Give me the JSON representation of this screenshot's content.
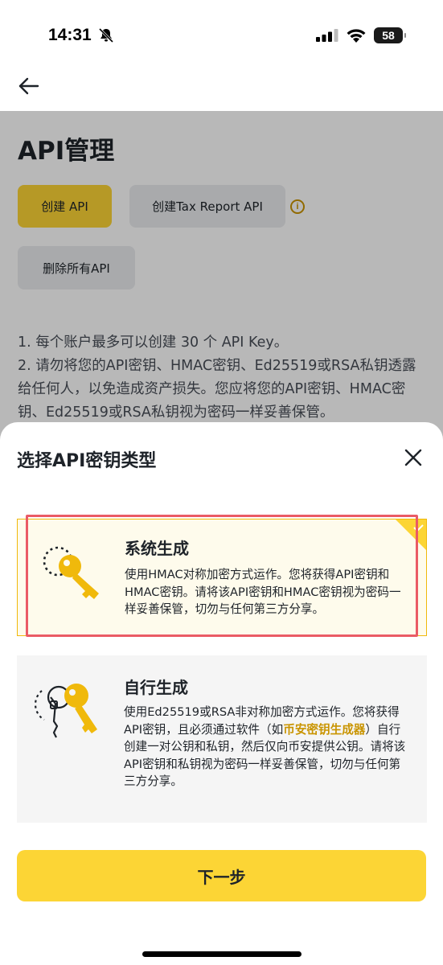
{
  "status_bar": {
    "time": "14:31",
    "battery": "58"
  },
  "page": {
    "title": "API管理",
    "buttons": {
      "create_api": "创建 API",
      "create_tax_api": "创建Tax Report API",
      "delete_all": "删除所有API"
    },
    "notes": [
      "1. 每个账户最多可以创建 30 个 API Key。",
      "2. 请勿将您的API密钥、HMAC密钥、Ed25519或RSA私钥透露给任何人，以免造成资产损失。您应将您的API密钥、HMAC密钥、Ed25519或RSA私钥视为密码一样妥善保管。"
    ]
  },
  "sheet": {
    "title": "选择API密钥类型",
    "options": [
      {
        "title": "系统生成",
        "description": "使用HMAC对称加密方式运作。您将获得API密钥和HMAC密钥。请将该API密钥和HMAC密钥视为密码一样妥善保管，切勿与任何第三方分享。",
        "selected": true
      },
      {
        "title": "自行生成",
        "description_before": "使用Ed25519或RSA非对称加密方式运作。您将获得API密钥，且必须通过软件（如",
        "description_link": "币安密钥生成器",
        "description_after": "）自行创建一对公钥和私钥，然后仅向币安提供公钥。请将该API密钥和私钥视为密码一样妥善保管，切勿与任何第三方分享。",
        "selected": false
      }
    ],
    "next_button": "下一步"
  },
  "icons": {
    "back": "arrow-left-icon",
    "close": "close-icon",
    "info": "info-icon",
    "system_key": "key-icon",
    "self_key": "key-pair-icon"
  },
  "colors": {
    "accent": "#fcd535",
    "accent_text": "#c99400",
    "selected_bg": "#fefbec",
    "highlight_border": "#ea5b65"
  }
}
